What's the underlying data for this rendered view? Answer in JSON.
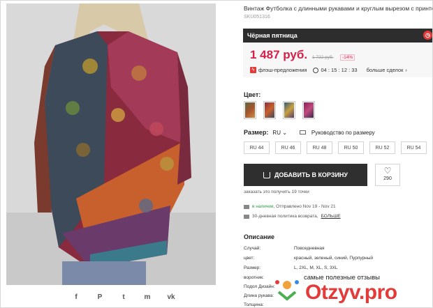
{
  "product": {
    "title": "Винтаж Футболка с длинными рукавами и круглым вырезом с принтом",
    "sku": "SKU051316"
  },
  "promo": {
    "banner": "Чёрная пятница",
    "price": "1 487 руб.",
    "old_price": "1 722 руб.",
    "discount": "-14%",
    "flash_label": "флэш-предложения",
    "timer": "04 : 15 : 12 : 33",
    "more_deals": "больше сделок",
    "more_deals_arrow": "›"
  },
  "color": {
    "label": "Цвет:",
    "swatches": [
      "#a5542c",
      "#8c2f3a",
      "#2f5a78",
      "#8b1f5a"
    ]
  },
  "size": {
    "label": "Размер:",
    "region": "RU",
    "guide": "Руководство по размеру",
    "options": [
      "RU 44",
      "RU 46",
      "RU 48",
      "RU 50",
      "RU 52",
      "RU 54"
    ]
  },
  "cart": {
    "add_label": "ДОБАВИТЬ В КОРЗИНУ",
    "wish_count": "290",
    "points": "заказать это получить 19 точки"
  },
  "shipping": {
    "status": "в наличии",
    "text": ", Отправлено Nov 19 - Nov 21",
    "return_text": "30-дневная политика возврата,",
    "return_link": "БОЛЬШЕ"
  },
  "description": {
    "title": "Описание",
    "specs": [
      {
        "k": "Случай:",
        "v": "Повседневная"
      },
      {
        "k": "цвет:",
        "v": "красный, зеленый, синий, Пурпурный"
      },
      {
        "k": "Размер:",
        "v": "L, 2XL, M, XL, S, 3XL"
      },
      {
        "k": "воротник:",
        "v": ""
      },
      {
        "k": "Подол Дизайн:",
        "v": ""
      },
      {
        "k": "Длина рукава:",
        "v": ""
      },
      {
        "k": "Толщина:",
        "v": ""
      }
    ]
  },
  "share": [
    "f",
    "P",
    "t",
    "m",
    "vk"
  ],
  "watermark": {
    "tagline": "самые полезные отзывы",
    "brand": "Otzyv.pro"
  },
  "colors": {
    "accent": "#d6204a",
    "dark": "#2d2d2d",
    "green": "#2e9a47"
  }
}
